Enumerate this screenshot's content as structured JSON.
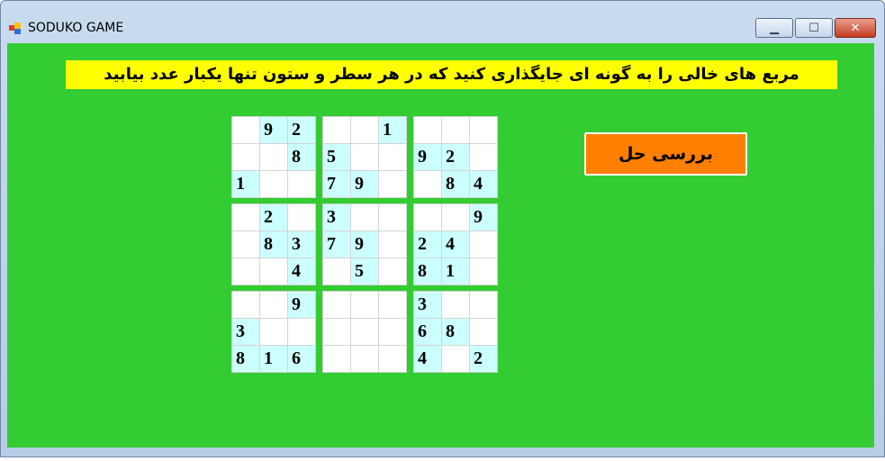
{
  "window": {
    "title": "SODUKO GAME"
  },
  "controls": {
    "minimize": "▁",
    "maximize": "☐",
    "close": "✕"
  },
  "instructions": "مربع های خالی را به گونه ای جایگذاری کنید که در هر سطر و ستون تنها یکبار عدد بیابید",
  "check_button": "بررسی حل",
  "colors": {
    "background": "#33cc33",
    "instruction_bg": "#ffff00",
    "button_bg": "#ff8000",
    "given_cell": "#ccffff",
    "empty_cell": "#ffffff"
  },
  "blocks": [
    [
      "",
      "9",
      "2",
      "",
      "",
      "8",
      "1",
      "",
      ""
    ],
    [
      "",
      "",
      "1",
      "5",
      "",
      "",
      "7",
      "9",
      ""
    ],
    [
      "",
      "",
      "",
      "9",
      "2",
      "",
      "",
      "8",
      "4"
    ],
    [
      "",
      "2",
      "",
      "",
      "8",
      "3",
      "",
      "",
      "4"
    ],
    [
      "3",
      "",
      "",
      "7",
      "9",
      "",
      "",
      "5",
      ""
    ],
    [
      "",
      "",
      "9",
      "2",
      "4",
      "",
      "8",
      "1",
      ""
    ],
    [
      "",
      "",
      "9",
      "3",
      "",
      "",
      "8",
      "1",
      "6"
    ],
    [
      "",
      "",
      "",
      "",
      "",
      "",
      "",
      "",
      ""
    ],
    [
      "3",
      "",
      "",
      "6",
      "8",
      "",
      "4",
      "",
      "2"
    ]
  ]
}
